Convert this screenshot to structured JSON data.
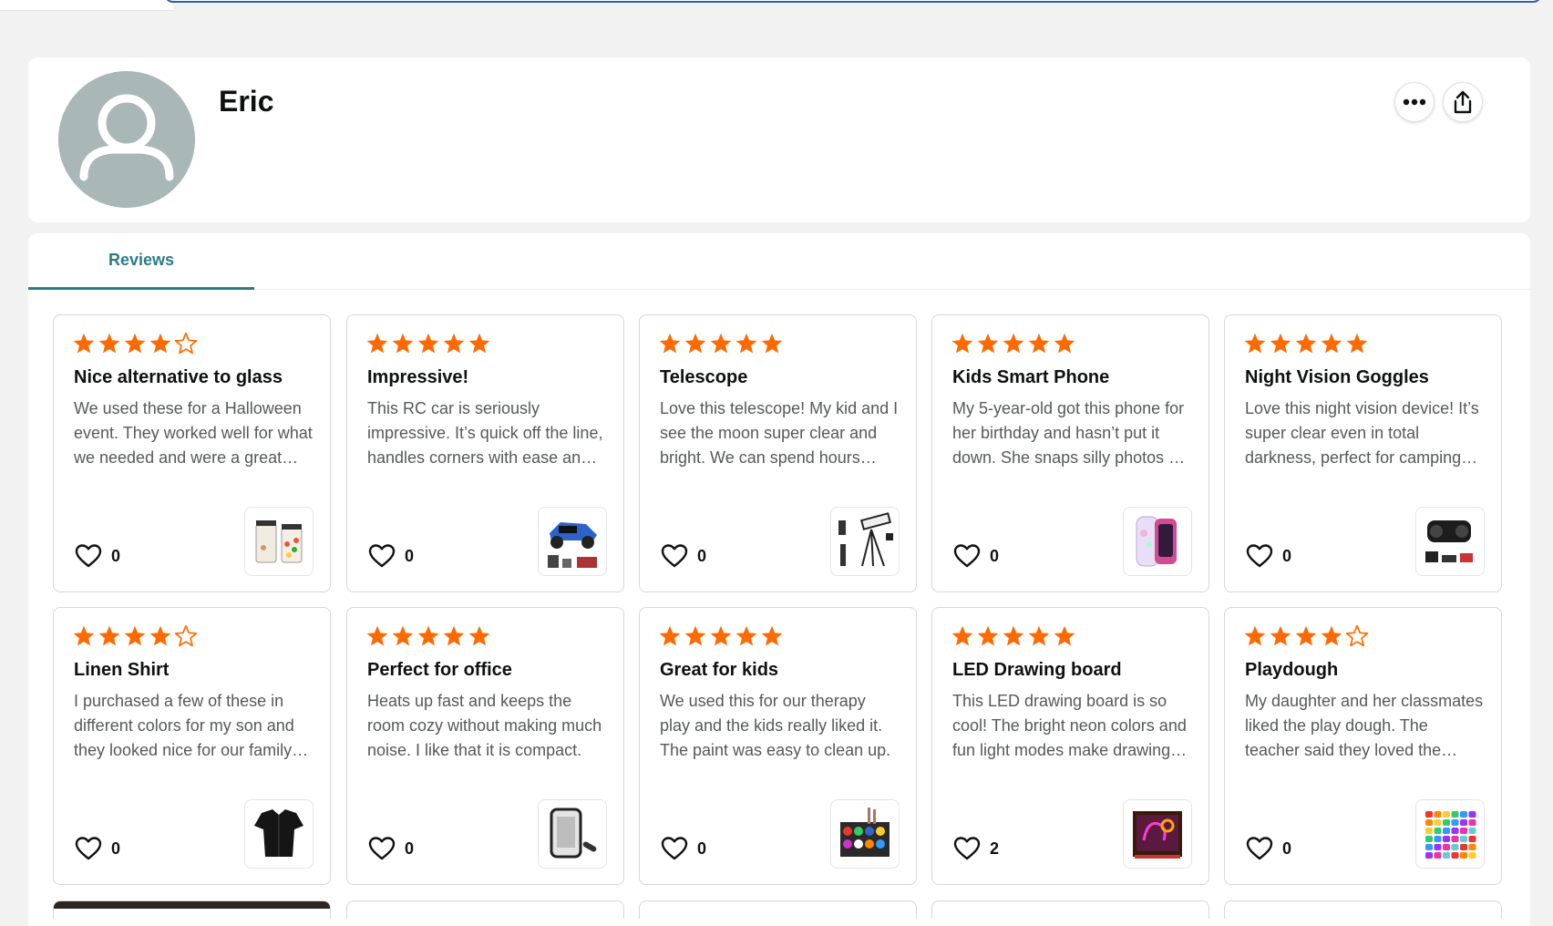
{
  "profile": {
    "name": "Eric"
  },
  "tabs": [
    {
      "label": "Reviews",
      "active": true
    }
  ],
  "colors": {
    "star": "#ff6a00",
    "tab_accent": "#2b7c87",
    "avatar_bg": "#aab7b7"
  },
  "reviews": [
    {
      "rating": 4,
      "title": "Nice alternative to glass",
      "body": "We used these for a Halloween event. They worked well for what we needed and were a great alternative to glass.",
      "helpful": "0",
      "thumb_icon": "jars-icon"
    },
    {
      "rating": 5,
      "title": "Impressive!",
      "body": "This RC car is seriously impressive. It’s quick off the line, handles corners with ease and is a lot of fun.",
      "helpful": "0",
      "thumb_icon": "rc-car-icon"
    },
    {
      "rating": 5,
      "title": "Telescope",
      "body": "Love this telescope! My kid and I see the moon super clear and bright. We can spend hours looking.",
      "helpful": "0",
      "thumb_icon": "telescope-icon"
    },
    {
      "rating": 5,
      "title": "Kids Smart Phone",
      "body": "My 5-year-old got this phone for her birthday and hasn’t put it down. She snaps silly photos all day.",
      "helpful": "0",
      "thumb_icon": "kids-phone-icon"
    },
    {
      "rating": 5,
      "title": "Night Vision Goggles",
      "body": "Love this night vision device! It’s super clear even in total darkness, perfect for camping trips.",
      "helpful": "0",
      "thumb_icon": "binoculars-icon"
    },
    {
      "rating": 4,
      "title": "Linen Shirt",
      "body": "I purchased a few of these in different colors for my son and they looked nice for our family photos.",
      "helpful": "0",
      "thumb_icon": "shirt-icon"
    },
    {
      "rating": 5,
      "title": "Perfect for office",
      "body": "Heats up fast and keeps the room cozy without making much noise. I like that it is compact.",
      "helpful": "0",
      "thumb_icon": "heater-icon"
    },
    {
      "rating": 5,
      "title": "Great for kids",
      "body": "We used this for our therapy play and the kids really liked it. The paint was easy to clean up.",
      "helpful": "0",
      "thumb_icon": "paint-set-icon"
    },
    {
      "rating": 5,
      "title": "LED Drawing board",
      "body": "This LED drawing board is so cool! The bright neon colors and fun light modes make drawing fun.",
      "helpful": "2",
      "thumb_icon": "led-board-icon"
    },
    {
      "rating": 4,
      "title": "Playdough",
      "body": "My daughter and her classmates liked the play dough. The teacher said they loved the colors.",
      "helpful": "0",
      "thumb_icon": "playdough-icon"
    }
  ]
}
